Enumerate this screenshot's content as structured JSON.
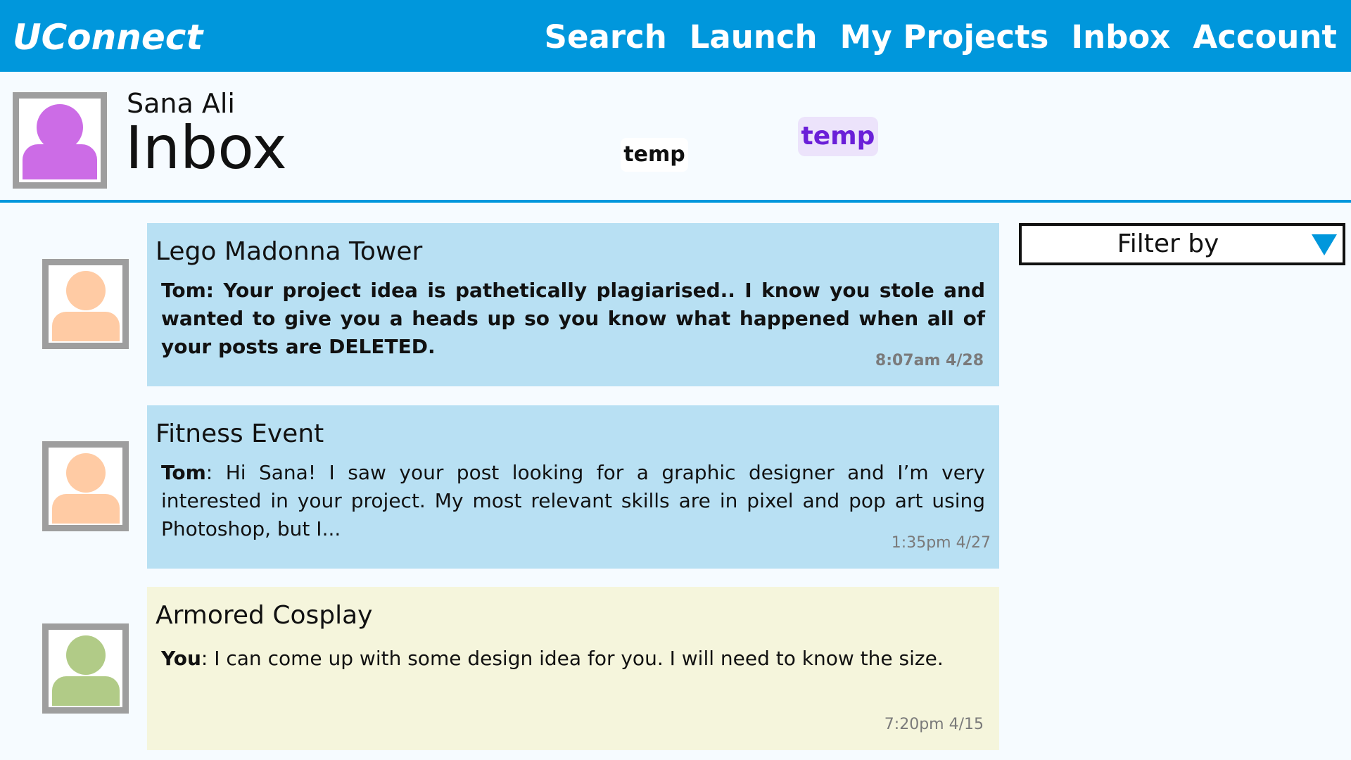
{
  "app": {
    "brand": "UConnect"
  },
  "nav": {
    "items": [
      "Search",
      "Launch",
      "My Projects",
      "Inbox",
      "Account"
    ]
  },
  "header": {
    "user_name": "Sana Ali",
    "title": "Inbox",
    "tag_white": "temp",
    "tag_purple": "temp"
  },
  "filter": {
    "label": "Filter by"
  },
  "messages": [
    {
      "title": "Lego Madonna Tower",
      "sender": "Tom",
      "text": "Tom: Your project idea is pathetically plagiarised.. I know you stole and wanted to give you a heads up so you know what happened when all of your posts are DELETED.",
      "time": "8:07am 4/28"
    },
    {
      "title": "Fitness Event",
      "sender": "Tom",
      "text": ": Hi Sana! I saw your post looking for a graphic designer and I’m very interested in your project. My most relevant skills are in pixel and pop art using Photoshop, but I...",
      "time": "1:35pm 4/27"
    },
    {
      "title": "Armored Cosplay",
      "sender": "You",
      "text": ": I can come up with some design idea for you. I will need to know the size.",
      "time": "7:20pm 4/15"
    }
  ],
  "colors": {
    "accent": "#0097dc",
    "card_blue": "#b8e0f3",
    "card_yellow": "#f5f5dc",
    "user_avatar": "#cc6ce6",
    "tom_avatar": "#ffcba4",
    "you_avatar": "#b1cb87",
    "tag_purple_text": "#6a1fd8"
  },
  "icons": {
    "filter_arrow": "triangle-down-icon",
    "avatar": "person-icon"
  }
}
